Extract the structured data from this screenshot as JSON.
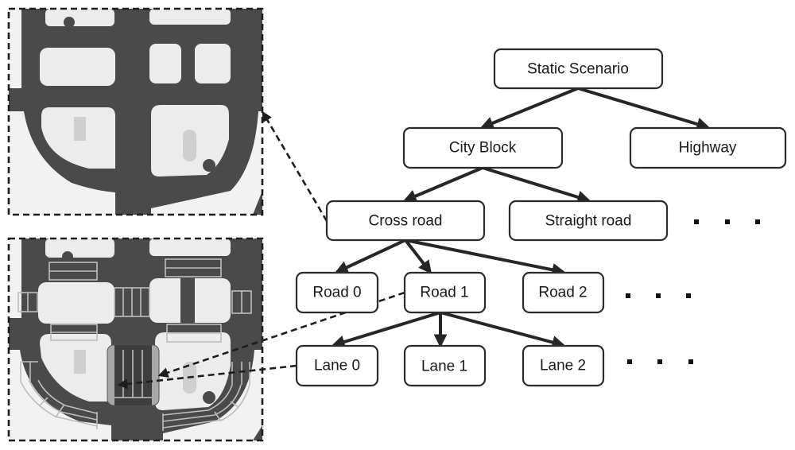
{
  "figure": {
    "tree": {
      "root": {
        "id": "static-scenario",
        "label": "Static Scenario"
      },
      "level1": [
        {
          "id": "city-block",
          "label": "City Block"
        },
        {
          "id": "highway",
          "label": "Highway"
        }
      ],
      "level2": [
        {
          "id": "cross-road",
          "label": "Cross road"
        },
        {
          "id": "straight-road",
          "label": "Straight road"
        }
      ],
      "level3": [
        {
          "id": "road-0",
          "label": "Road 0"
        },
        {
          "id": "road-1",
          "label": "Road 1"
        },
        {
          "id": "road-2",
          "label": "Road 2"
        }
      ],
      "level4": [
        {
          "id": "lane-0",
          "label": "Lane 0"
        },
        {
          "id": "lane-1",
          "label": "Lane 1"
        },
        {
          "id": "lane-2",
          "label": "Lane 2"
        }
      ],
      "edges": [
        [
          "static-scenario",
          "city-block"
        ],
        [
          "static-scenario",
          "highway"
        ],
        [
          "city-block",
          "cross-road"
        ],
        [
          "city-block",
          "straight-road"
        ],
        [
          "cross-road",
          "road-0"
        ],
        [
          "cross-road",
          "road-1"
        ],
        [
          "cross-road",
          "road-2"
        ],
        [
          "road-1",
          "lane-0"
        ],
        [
          "road-1",
          "lane-1"
        ],
        [
          "road-1",
          "lane-2"
        ]
      ],
      "ellipsis_after": [
        "straight-road",
        "road-2",
        "lane-2"
      ],
      "map_links": [
        {
          "from": "cross-road",
          "to": "top-map"
        },
        {
          "from": "road-1",
          "to": "highlighted-road"
        },
        {
          "from": "lane-0",
          "to": "highlighted-lane"
        }
      ]
    },
    "maps": {
      "top": {
        "description": "city block map without lane segmentation"
      },
      "bottom": {
        "description": "city block map with road and lane segmentation, one road highlighted"
      }
    },
    "colors": {
      "road": "#4a4a4a",
      "block": "#ececec",
      "highlight": "#a8a8a8",
      "line": "#262626"
    }
  }
}
